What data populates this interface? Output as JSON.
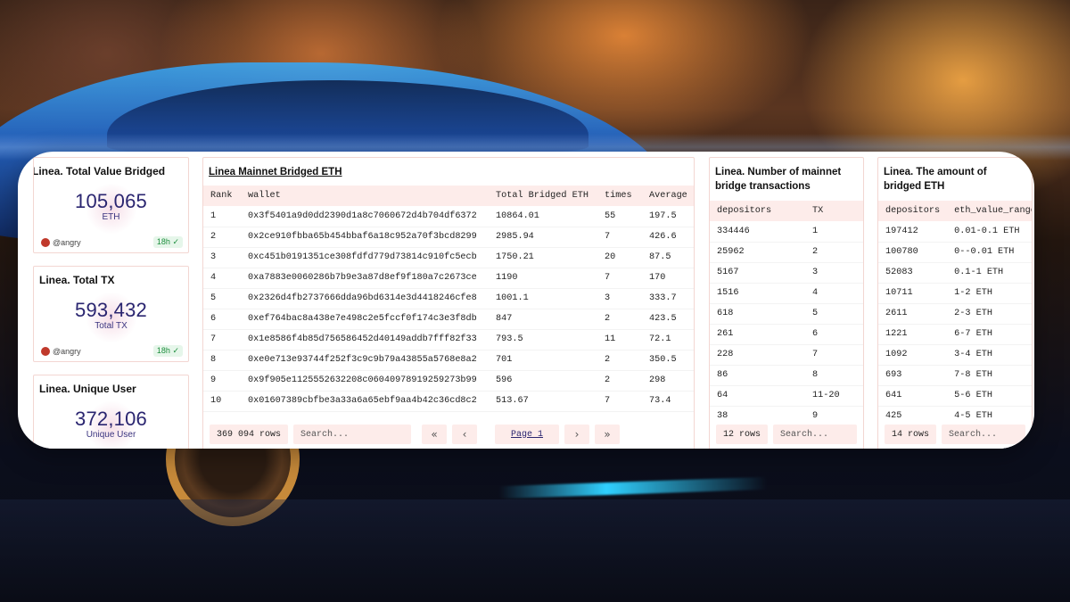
{
  "counters": [
    {
      "title": "Linea. Total Value Bridged",
      "value": "105,065",
      "unit": "ETH",
      "author": "@angry",
      "freshness": "18h"
    },
    {
      "title": "Linea. Total TX",
      "value": "593,432",
      "unit": "Total TX",
      "author": "@angry",
      "freshness": "18h"
    },
    {
      "title": "Linea. Unique User",
      "value": "372,106",
      "unit": "Unique User"
    }
  ],
  "mainnet_table": {
    "title": "Linea Mainnet Bridged ETH",
    "columns": [
      "Rank",
      "wallet",
      "Total Bridged ETH",
      "times",
      "Average"
    ],
    "rows": [
      [
        "1",
        "0x3f5401a9d0dd2390d1a8c7060672d4b704df6372",
        "10864.01",
        "55",
        "197.5"
      ],
      [
        "2",
        "0x2ce910fbba65b454bbaf6a18c952a70f3bcd8299",
        "2985.94",
        "7",
        "426.6"
      ],
      [
        "3",
        "0xc451b0191351ce308fdfd779d73814c910fc5ecb",
        "1750.21",
        "20",
        "87.5"
      ],
      [
        "4",
        "0xa7883e0060286b7b9e3a87d8ef9f180a7c2673ce",
        "1190",
        "7",
        "170"
      ],
      [
        "5",
        "0x2326d4fb2737666dda96bd6314e3d4418246cfe8",
        "1001.1",
        "3",
        "333.7"
      ],
      [
        "6",
        "0xef764bac8a438e7e498c2e5fccf0f174c3e3f8db",
        "847",
        "2",
        "423.5"
      ],
      [
        "7",
        "0x1e8586f4b85d756586452d40149addb7fff82f33",
        "793.5",
        "11",
        "72.1"
      ],
      [
        "8",
        "0xe0e713e93744f252f3c9c9b79a43855a5768e8a2",
        "701",
        "2",
        "350.5"
      ],
      [
        "9",
        "0x9f905e1125552632208c06040978919259273b99",
        "596",
        "2",
        "298"
      ],
      [
        "10",
        "0x01607389cbfbe3a33a6a65ebf9aa4b42c36cd8c2",
        "513.67",
        "7",
        "73.4"
      ]
    ],
    "row_count": "369 094 rows",
    "search_placeholder": "Search...",
    "page_label": "Page 1"
  },
  "tx_table": {
    "title": "Linea. Number of mainnet bridge transactions",
    "columns": [
      "depositors",
      "TX"
    ],
    "rows": [
      [
        "334446",
        "1"
      ],
      [
        "25962",
        "2"
      ],
      [
        "5167",
        "3"
      ],
      [
        "1516",
        "4"
      ],
      [
        "618",
        "5"
      ],
      [
        "261",
        "6"
      ],
      [
        "228",
        "7"
      ],
      [
        "86",
        "8"
      ],
      [
        "64",
        "11-20"
      ],
      [
        "38",
        "9"
      ]
    ],
    "row_count": "12 rows",
    "search_placeholder": "Search..."
  },
  "amount_table": {
    "title": "Linea. The amount of bridged ETH",
    "columns": [
      "depositors",
      "eth_value_range"
    ],
    "rows": [
      [
        "197412",
        "0.01-0.1 ETH"
      ],
      [
        "100780",
        "0--0.01 ETH"
      ],
      [
        "52083",
        "0.1-1 ETH"
      ],
      [
        "10711",
        "1-2 ETH"
      ],
      [
        "2611",
        "2-3 ETH"
      ],
      [
        "1221",
        "6-7 ETH"
      ],
      [
        "1092",
        "3-4 ETH"
      ],
      [
        "693",
        "7-8 ETH"
      ],
      [
        "641",
        "5-6 ETH"
      ],
      [
        "425",
        "4-5 ETH"
      ]
    ],
    "row_count": "14 rows",
    "search_placeholder": "Search..."
  },
  "icons": {
    "fresh": "check-circle-icon",
    "first": "double-chevron-left-icon",
    "prev": "chevron-left-icon",
    "next": "chevron-right-icon",
    "last": "double-chevron-right-icon"
  }
}
